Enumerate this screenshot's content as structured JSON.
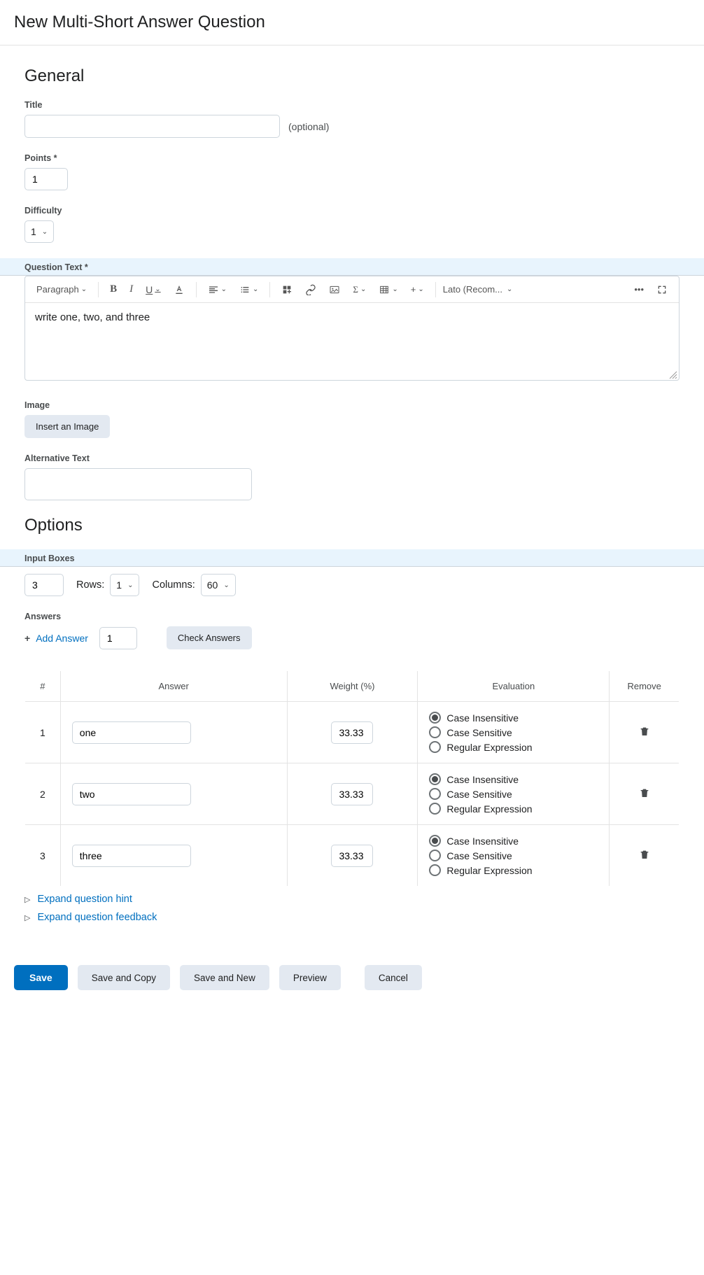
{
  "header": {
    "title": "New Multi-Short Answer Question"
  },
  "general": {
    "heading": "General",
    "title_label": "Title",
    "title_value": "",
    "optional": "(optional)",
    "points_label": "Points *",
    "points_value": "1",
    "difficulty_label": "Difficulty",
    "difficulty_value": "1",
    "question_text_label": "Question Text *",
    "editor": {
      "paragraph": "Paragraph",
      "font": "Lato (Recom...",
      "content": "write one, two, and three"
    },
    "image_label": "Image",
    "insert_image_btn": "Insert an Image",
    "alt_text_label": "Alternative Text",
    "alt_text_value": ""
  },
  "options": {
    "heading": "Options",
    "input_boxes_label": "Input Boxes",
    "input_boxes_value": "3",
    "rows_label": "Rows:",
    "rows_value": "1",
    "columns_label": "Columns:",
    "columns_value": "60",
    "answers_label": "Answers",
    "add_answer": "Add Answer",
    "add_answer_count": "1",
    "check_answers": "Check Answers",
    "table": {
      "col_num": "#",
      "col_answer": "Answer",
      "col_weight": "Weight (%)",
      "col_eval": "Evaluation",
      "col_remove": "Remove",
      "eval_ci": "Case Insensitive",
      "eval_cs": "Case Sensitive",
      "eval_re": "Regular Expression",
      "rows": [
        {
          "num": "1",
          "answer": "one",
          "weight": "33.33"
        },
        {
          "num": "2",
          "answer": "two",
          "weight": "33.33"
        },
        {
          "num": "3",
          "answer": "three",
          "weight": "33.33"
        }
      ]
    },
    "expand_hint": "Expand question hint",
    "expand_feedback": "Expand question feedback"
  },
  "footer": {
    "save": "Save",
    "save_copy": "Save and Copy",
    "save_new": "Save and New",
    "preview": "Preview",
    "cancel": "Cancel"
  }
}
